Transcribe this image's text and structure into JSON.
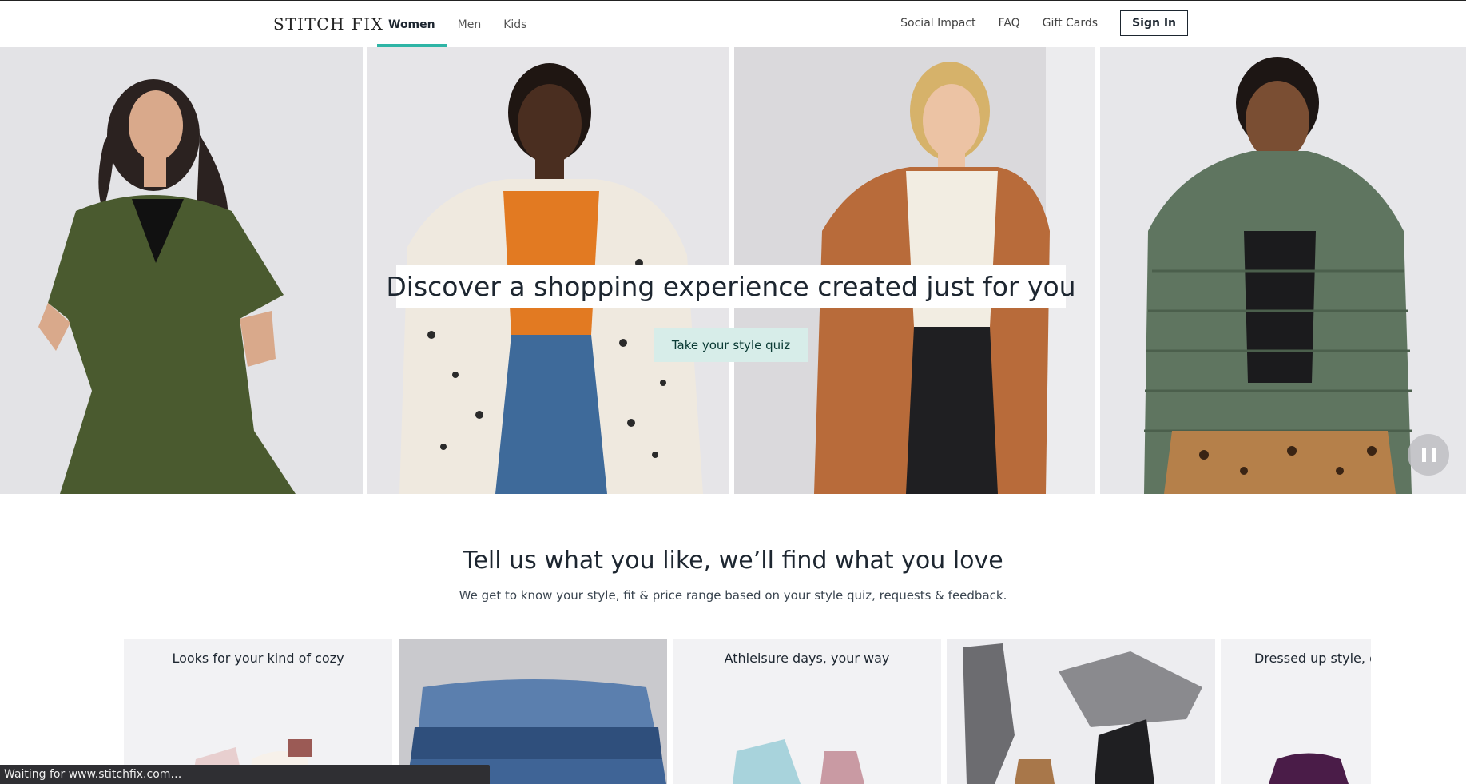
{
  "header": {
    "logo": "STITCH FIX",
    "tabs": [
      {
        "label": "Women",
        "active": true
      },
      {
        "label": "Men",
        "active": false
      },
      {
        "label": "Kids",
        "active": false
      }
    ],
    "links": [
      "Social Impact",
      "FAQ",
      "Gift Cards"
    ],
    "sign_in_label": "Sign In"
  },
  "hero": {
    "title": "Discover a shopping experience created just for you",
    "cta_label": "Take your style quiz",
    "pause_icon": "pause-icon"
  },
  "section": {
    "title": "Tell us what you like, we’ll find what you love",
    "subtitle": "We get to know your style, fit & price range based on your style quiz, requests & feedback."
  },
  "cards": [
    {
      "title": "Looks for your kind of cozy"
    },
    {
      "title": ""
    },
    {
      "title": "Athleisure days, your way"
    },
    {
      "title": ""
    },
    {
      "title": "Dressed up style, d"
    }
  ],
  "status_bar": "Waiting for www.stitchfix.com…",
  "colors": {
    "accent": "#2fb5a6",
    "cta_bg": "#d7ede9",
    "text": "#1d2630"
  }
}
